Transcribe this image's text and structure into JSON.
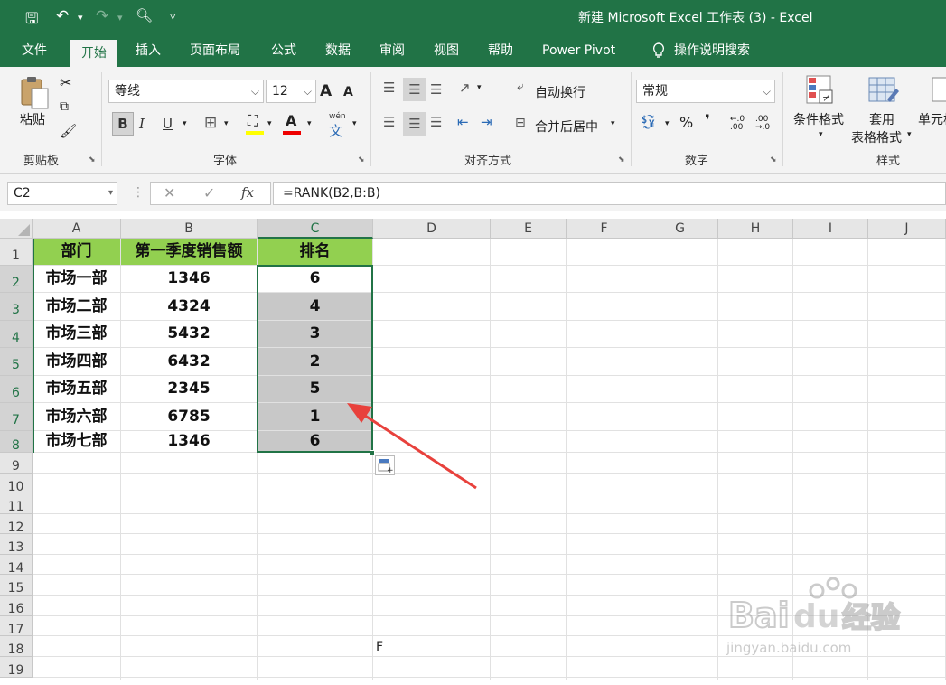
{
  "window": {
    "title": "新建 Microsoft Excel 工作表 (3)  -  Excel",
    "qat": {
      "save": "🖫",
      "undo": "↶",
      "undo_drop": "▾",
      "redo": "↷",
      "redo_drop": "▾",
      "preview": "🔍︎",
      "customize": "▿"
    }
  },
  "tabs": [
    "文件",
    "开始",
    "插入",
    "页面布局",
    "公式",
    "数据",
    "审阅",
    "视图",
    "帮助",
    "Power Pivot",
    "操作说明搜索"
  ],
  "ribbon": {
    "clipboard": {
      "paste": "粘贴",
      "group": "剪贴板"
    },
    "font": {
      "name": "等线",
      "size": "12",
      "grow": "A",
      "shrink": "A",
      "bold": "B",
      "italic": "I",
      "underline": "U",
      "phonetic": "wén",
      "group": "字体"
    },
    "align": {
      "wrap": "自动换行",
      "merge": "合并后居中",
      "group": "对齐方式"
    },
    "number": {
      "format": "常规",
      "percent": "%",
      "comma": "❜",
      "inc": "←.0 .00",
      "dec": ".00 →.0",
      "group": "数字"
    },
    "styles": {
      "cond": "条件格式",
      "table1": "套用",
      "table2": "表格格式",
      "cell": "单元格",
      "group": "样式"
    }
  },
  "formula_bar": {
    "name_box": "C2",
    "cancel": "✕",
    "enter": "✓",
    "fx": "fx",
    "formula": "=RANK(B2,B:B)"
  },
  "columns": [
    "A",
    "B",
    "C",
    "D",
    "E",
    "F",
    "G",
    "H",
    "I",
    "J"
  ],
  "rows": [
    "1",
    "2",
    "3",
    "4",
    "5",
    "6",
    "7",
    "8",
    "9",
    "10",
    "11",
    "12",
    "13",
    "14",
    "15",
    "16",
    "17",
    "18",
    "19"
  ],
  "table": {
    "headers": [
      "部门",
      "第一季度销售额",
      "排名"
    ],
    "data": [
      [
        "市场一部",
        "1346",
        "6"
      ],
      [
        "市场二部",
        "4324",
        "4"
      ],
      [
        "市场三部",
        "5432",
        "3"
      ],
      [
        "市场四部",
        "6432",
        "2"
      ],
      [
        "市场五部",
        "2345",
        "5"
      ],
      [
        "市场六部",
        "6785",
        "1"
      ],
      [
        "市场七部",
        "1346",
        "6"
      ]
    ]
  },
  "stray_cell_d18": "F",
  "accent": "#217346",
  "header_fill": "#92d050",
  "arrow_color": "#e8413c"
}
